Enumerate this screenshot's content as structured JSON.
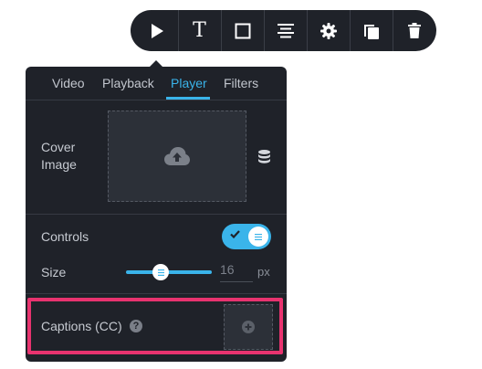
{
  "toolbar": {
    "items": [
      {
        "name": "play",
        "icon": "play-icon"
      },
      {
        "name": "text",
        "icon": "text-icon",
        "glyph": "T"
      },
      {
        "name": "box",
        "icon": "square-icon"
      },
      {
        "name": "align",
        "icon": "align-center-icon"
      },
      {
        "name": "settings",
        "icon": "gear-icon"
      },
      {
        "name": "duplicate",
        "icon": "copy-icon"
      },
      {
        "name": "delete",
        "icon": "trash-icon"
      }
    ]
  },
  "panel": {
    "tabs": [
      {
        "label": "Video",
        "active": false
      },
      {
        "label": "Playback",
        "active": false
      },
      {
        "label": "Player",
        "active": true
      },
      {
        "label": "Filters",
        "active": false
      }
    ],
    "cover_image": {
      "label_line1": "Cover",
      "label_line2": "Image",
      "upload_icon": "cloud-upload-icon",
      "library_icon": "database-icon"
    },
    "controls": {
      "label": "Controls",
      "enabled": true
    },
    "size": {
      "label": "Size",
      "value": "16",
      "unit": "px",
      "slider_fraction": 0.42
    },
    "captions": {
      "label": "Captions (CC)",
      "help_glyph": "?",
      "add_icon": "plus-circle-icon"
    }
  },
  "colors": {
    "panel_bg": "#1f2229",
    "accent": "#3ab4ea",
    "highlight": "#e8336f",
    "text": "#c6cad1"
  }
}
